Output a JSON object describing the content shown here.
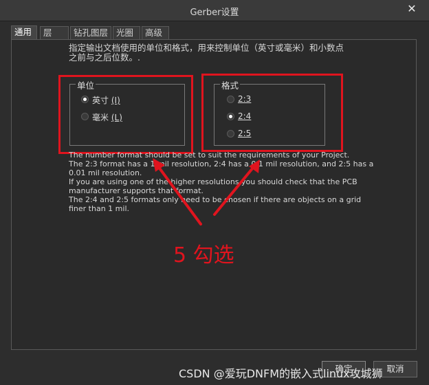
{
  "window": {
    "title": "Gerber设置",
    "close_symbol": "✕"
  },
  "tabs": [
    "通用",
    "层",
    "钻孔图层",
    "光圈",
    "高级"
  ],
  "description": {
    "line1": "指定输出文档使用的单位和格式，用来控制单位（英寸或毫米）和小数点",
    "line2": "之前与之后位数。."
  },
  "units": {
    "legend": "单位",
    "options": [
      {
        "label": "英寸",
        "hotkey": "(I)",
        "selected": true
      },
      {
        "label": "毫米",
        "hotkey": "(L)",
        "selected": false
      }
    ]
  },
  "format": {
    "legend": "格式",
    "options": [
      {
        "label": "2:3",
        "selected": false
      },
      {
        "label": "2:4",
        "selected": true
      },
      {
        "label": "2:5",
        "selected": false
      }
    ]
  },
  "info_lines": [
    "The number format should be set to suit the requirements of your Project.",
    "The 2:3 format has a 1 mil resolution, 2:4 has a 0.1 mil resolution, and 2:5 has a",
    "0.01 mil resolution.",
    "If you are using one of the higher resolutions you should check that the PCB",
    "manufacturer supports that format.",
    "The 2:4 and 2:5 formats only need to be chosen if there are objects on a grid",
    "finer than 1 mil."
  ],
  "annotation": "5 勾选",
  "watermark": "CSDN @爱玩DNFM的嵌入式linux攻城狮",
  "buttons": {
    "ok": "确定",
    "cancel": "取消"
  },
  "colors": {
    "annotation_red": "#e0141e"
  }
}
